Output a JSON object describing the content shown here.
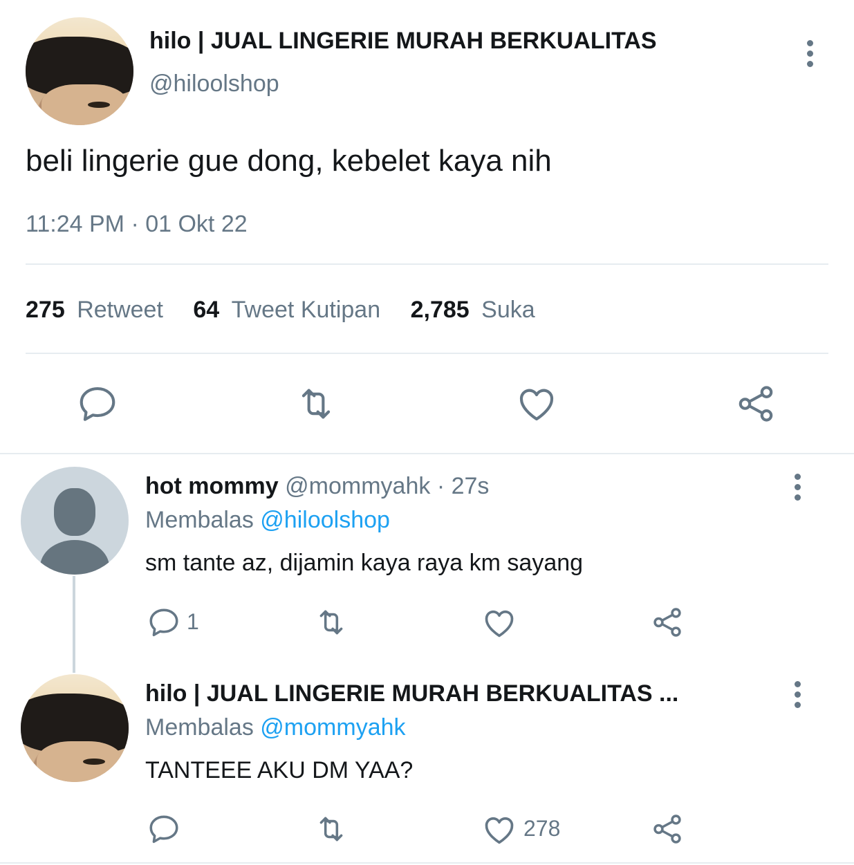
{
  "main_tweet": {
    "display_name": "hilo | JUAL LINGERIE MURAH BERKUALITAS",
    "handle": "@hiloolshop",
    "text": "beli lingerie gue dong, kebelet kaya nih",
    "timestamp": "11:24 PM · 01 Okt 22",
    "stats": {
      "retweet_count": "275",
      "retweet_label": "Retweet",
      "quote_count": "64",
      "quote_label": "Tweet Kutipan",
      "like_count": "2,785",
      "like_label": "Suka"
    },
    "actions": [
      "reply-icon",
      "retweet-icon",
      "like-icon",
      "share-icon"
    ]
  },
  "replies": [
    {
      "display_name": "hot mommy",
      "handle": "@mommyahk",
      "time": "· 27s",
      "replying_label": "Membalas",
      "replying_to": "@hiloolshop",
      "text": "sm tante az, dijamin kaya raya km sayang",
      "reply_count": "1",
      "retweet_count": "",
      "like_count": ""
    },
    {
      "display_name": "hilo | JUAL LINGERIE MURAH BERKUALITAS ...",
      "handle": "",
      "time": "",
      "replying_label": "Membalas",
      "replying_to": "@mommyahk",
      "text": "TANTEEE AKU DM YAA?",
      "reply_count": "",
      "retweet_count": "",
      "like_count": "278"
    }
  ],
  "colors": {
    "text": "#14171a",
    "muted": "#657786",
    "link": "#1da1f2",
    "divider": "#e6ecf0"
  }
}
